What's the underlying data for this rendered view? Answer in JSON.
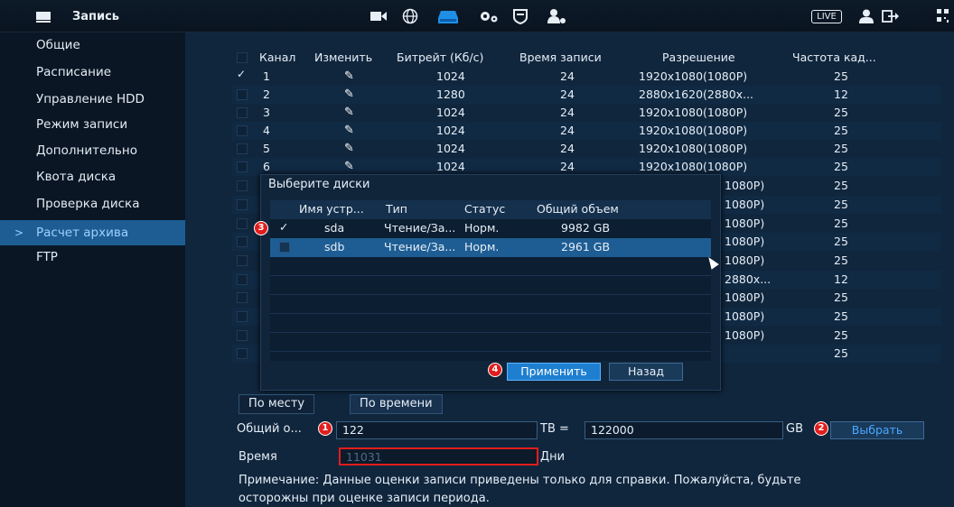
{
  "header": {
    "title": "Запись",
    "live_label": "LIVE"
  },
  "sidebar": {
    "items": [
      {
        "label": "Общие"
      },
      {
        "label": "Расписание"
      },
      {
        "label": "Управление HDD"
      },
      {
        "label": "Режим записи"
      },
      {
        "label": "Дополнительно"
      },
      {
        "label": "Квота диска"
      },
      {
        "label": "Проверка диска"
      },
      {
        "label": "Расчет архива",
        "active": true
      },
      {
        "label": "FTP"
      }
    ],
    "active_arrow": ">"
  },
  "channel_table": {
    "headers": [
      "Канал",
      "Изменить",
      "Битрейт (Кб/с)",
      "Время записи",
      "Разрешение",
      "Частота кад..."
    ],
    "rows": [
      {
        "channel": "1",
        "bitrate": "1024",
        "time": "24",
        "resolution": "1920x1080(1080P)",
        "fps": "25",
        "checked": true
      },
      {
        "channel": "2",
        "bitrate": "1280",
        "time": "24",
        "resolution": "2880x1620(2880x...",
        "fps": "12"
      },
      {
        "channel": "3",
        "bitrate": "1024",
        "time": "24",
        "resolution": "1920x1080(1080P)",
        "fps": "25"
      },
      {
        "channel": "4",
        "bitrate": "1024",
        "time": "24",
        "resolution": "1920x1080(1080P)",
        "fps": "25"
      },
      {
        "channel": "5",
        "bitrate": "1024",
        "time": "24",
        "resolution": "1920x1080(1080P)",
        "fps": "25"
      },
      {
        "channel": "6",
        "bitrate": "1024",
        "time": "24",
        "resolution": "1920x1080(1080P)",
        "fps": "25"
      },
      {
        "channel": "",
        "bitrate": "",
        "time": "",
        "resolution": "1080P)",
        "fps": "25"
      },
      {
        "channel": "",
        "bitrate": "",
        "time": "",
        "resolution": "1080P)",
        "fps": "25"
      },
      {
        "channel": "",
        "bitrate": "",
        "time": "",
        "resolution": "1080P)",
        "fps": "25"
      },
      {
        "channel": "",
        "bitrate": "",
        "time": "",
        "resolution": "1080P)",
        "fps": "25"
      },
      {
        "channel": "",
        "bitrate": "",
        "time": "",
        "resolution": "1080P)",
        "fps": "25"
      },
      {
        "channel": "",
        "bitrate": "",
        "time": "",
        "resolution": "2880x...",
        "fps": "12"
      },
      {
        "channel": "",
        "bitrate": "",
        "time": "",
        "resolution": "1080P)",
        "fps": "25"
      },
      {
        "channel": "",
        "bitrate": "",
        "time": "",
        "resolution": "1080P)",
        "fps": "25"
      },
      {
        "channel": "",
        "bitrate": "",
        "time": "",
        "resolution": "1080P)",
        "fps": "25"
      },
      {
        "channel": "",
        "bitrate": "",
        "time": "",
        "resolution": "",
        "fps": "25"
      }
    ]
  },
  "disk_dialog": {
    "title": "Выберите диски",
    "headers": [
      "Имя устр...",
      "Тип",
      "Статус",
      "Общий объем"
    ],
    "rows": [
      {
        "name": "sda",
        "type": "Чтение/За...",
        "status": "Норм.",
        "size": "9982 GB",
        "checked": true
      },
      {
        "name": "sdb",
        "type": "Чтение/За...",
        "status": "Норм.",
        "size": "2961 GB",
        "selected": true
      }
    ],
    "apply_label": "Применить",
    "back_label": "Назад"
  },
  "calc": {
    "tabs": [
      "По месту",
      "По времени"
    ],
    "total_label": "Общий о...",
    "total_value": "122",
    "tb_label": "TB =",
    "gb_value": "122000",
    "gb_label": "GB",
    "select_label": "Выбрать",
    "time_label": "Время",
    "time_value": "11031",
    "days_label": "Дни",
    "note_line1": "Примечание: Данные оценки записи приведены только для справки. Пожалуйста, будьте",
    "note_line2": "осторожны при оценке записи периода."
  },
  "callouts": [
    "1",
    "2",
    "3",
    "4"
  ],
  "colors": {
    "accent": "#1d5d93",
    "button": "#1e7fd0",
    "highlight_border": "#e21d1d",
    "select_text": "#4aa8ff"
  }
}
